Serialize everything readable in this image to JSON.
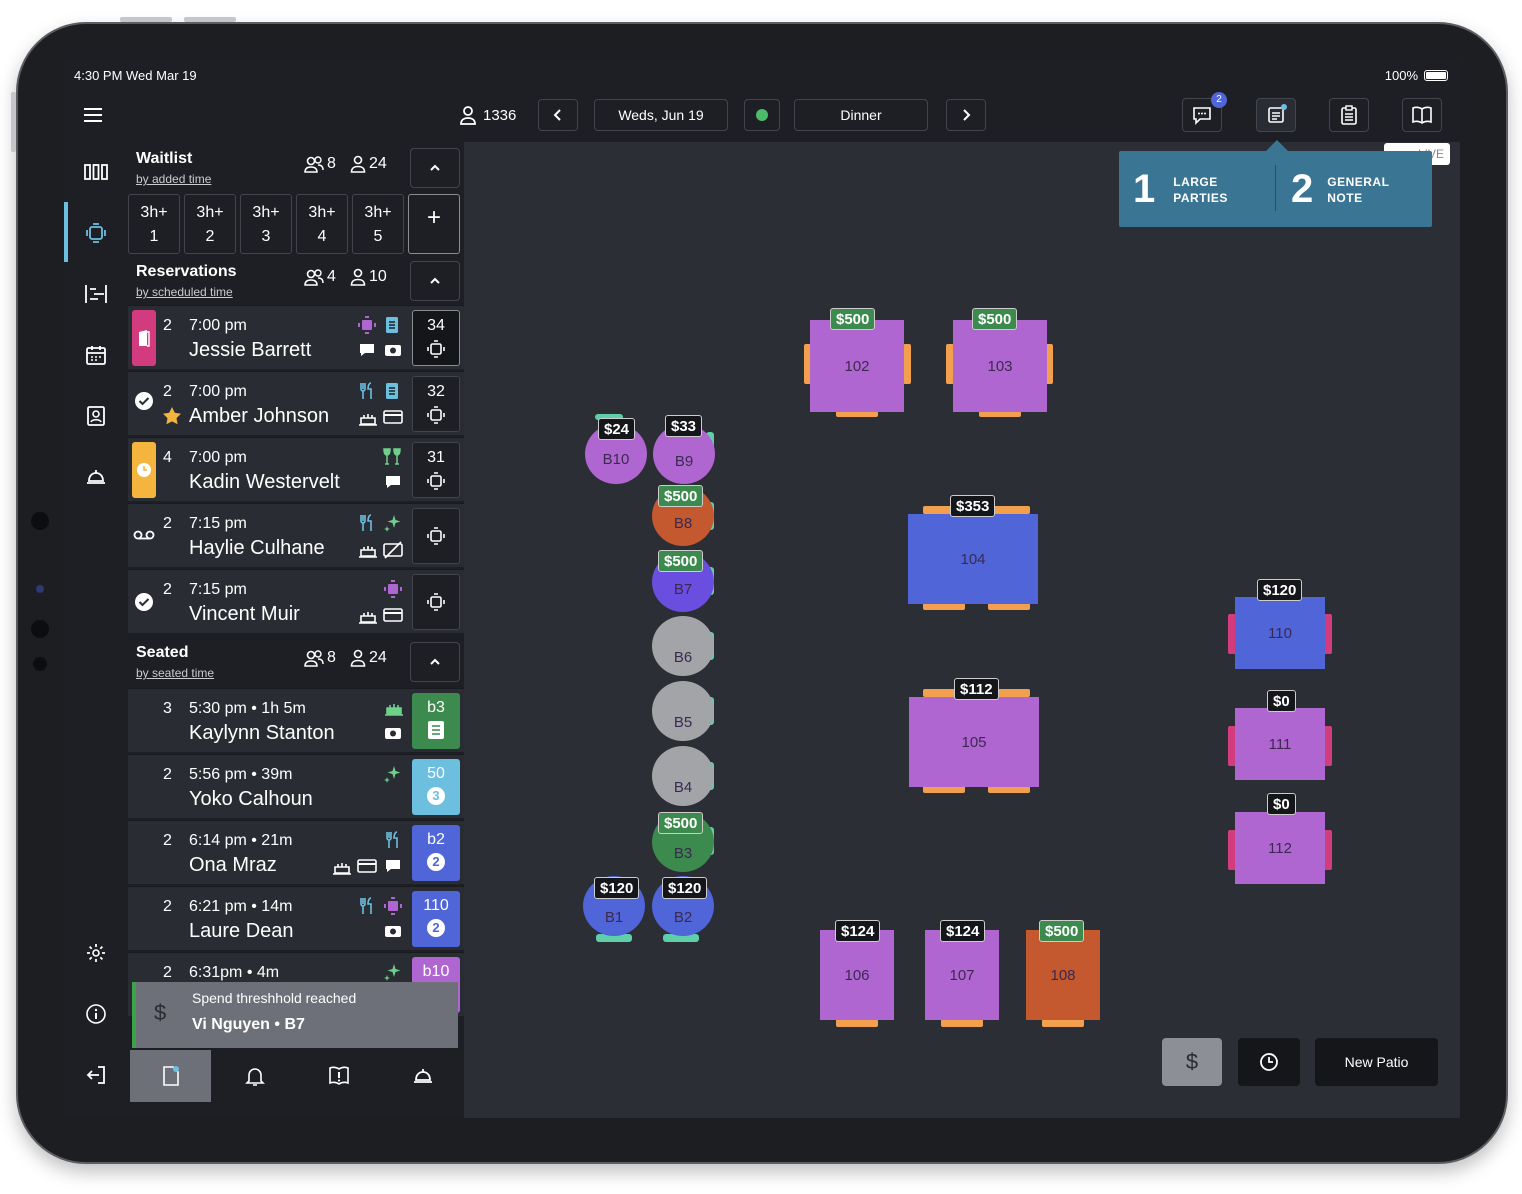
{
  "status_bar": {
    "time_date": "4:30 PM  Wed Mar 19",
    "battery": "100%"
  },
  "topbar": {
    "guest_count": "1336",
    "date": "Weds, Jun 19",
    "shift": "Dinner",
    "messages_badge": "2"
  },
  "popover": {
    "items": [
      {
        "count": "1",
        "line1": "LARGE",
        "line2": "PARTIES"
      },
      {
        "count": "2",
        "line1": "GENERAL",
        "line2": "NOTE"
      }
    ],
    "hidden_tag": "LIVE"
  },
  "waitlist": {
    "title": "Waitlist",
    "subtitle": "by added time",
    "parties": "8",
    "covers": "24",
    "entries": [
      {
        "time": "3h+",
        "num": "1"
      },
      {
        "time": "3h+",
        "num": "2"
      },
      {
        "time": "3h+",
        "num": "3"
      },
      {
        "time": "3h+",
        "num": "4"
      },
      {
        "time": "3h+",
        "num": "5"
      }
    ],
    "add_label": "+"
  },
  "reservations": {
    "title": "Reservations",
    "subtitle": "by scheduled time",
    "parties": "4",
    "covers": "10",
    "rows": [
      {
        "party": "2",
        "time": "7:00 pm",
        "name": "Jessie Barrett",
        "table": "34"
      },
      {
        "party": "2",
        "time": "7:00 pm",
        "name": "Amber Johnson",
        "table": "32"
      },
      {
        "party": "4",
        "time": "7:00 pm",
        "name": "Kadin Westervelt",
        "table": "31"
      },
      {
        "party": "2",
        "time": "7:15 pm",
        "name": "Haylie Culhane",
        "table": ""
      },
      {
        "party": "2",
        "time": "7:15 pm",
        "name": "Vincent Muir",
        "table": ""
      }
    ]
  },
  "seated": {
    "title": "Seated",
    "subtitle": "by seated time",
    "parties": "8",
    "covers": "24",
    "rows": [
      {
        "party": "3",
        "time": "5:30 pm • 1h 5m",
        "name": "Kaylynn Stanton",
        "table": "b3",
        "sub": "",
        "color": "#3c8a4d"
      },
      {
        "party": "2",
        "time": "5:56 pm • 39m",
        "name": "Yoko Calhoun",
        "table": "50",
        "sub": "3",
        "color": "#6dbfe0"
      },
      {
        "party": "2",
        "time": "6:14 pm • 21m",
        "name": "Ona Mraz",
        "table": "b2",
        "sub": "2",
        "color": "#4f65d8"
      },
      {
        "party": "2",
        "time": "6:21 pm • 14m",
        "name": "Laure Dean",
        "table": "110",
        "sub": "2",
        "color": "#4f65d8"
      },
      {
        "party": "2",
        "time": "6:31pm  • 4m",
        "name": "",
        "table": "b10",
        "sub": "",
        "color": "#b066d0"
      }
    ]
  },
  "toast": {
    "title": "Spend threshhold reached",
    "detail": "Vi Nguyen • B7",
    "icon": "$"
  },
  "floor": {
    "tables": [
      {
        "id": "102",
        "price": "$500",
        "price_style": "green",
        "fill": "#b066d0"
      },
      {
        "id": "103",
        "price": "$500",
        "price_style": "green",
        "fill": "#b066d0"
      },
      {
        "id": "B10",
        "price": "$24",
        "price_style": "dark",
        "fill": "#b066d0"
      },
      {
        "id": "B9",
        "price": "$33",
        "price_style": "dark",
        "fill": "#b066d0"
      },
      {
        "id": "B8",
        "price": "$500",
        "price_style": "green",
        "fill": "#c4582e"
      },
      {
        "id": "B7",
        "price": "$500",
        "price_style": "green",
        "fill": "#6a4ee0"
      },
      {
        "id": "B6",
        "price": "",
        "price_style": "",
        "fill": "#a3a4a8"
      },
      {
        "id": "B5",
        "price": "",
        "price_style": "",
        "fill": "#a3a4a8"
      },
      {
        "id": "B4",
        "price": "",
        "price_style": "",
        "fill": "#a3a4a8"
      },
      {
        "id": "B3",
        "price": "$500",
        "price_style": "green",
        "fill": "#3c8a4d"
      },
      {
        "id": "B1",
        "price": "$120",
        "price_style": "dark",
        "fill": "#4f65d8"
      },
      {
        "id": "B2",
        "price": "$120",
        "price_style": "dark",
        "fill": "#4f65d8"
      },
      {
        "id": "104",
        "price": "$353",
        "price_style": "dark",
        "fill": "#4f65d8"
      },
      {
        "id": "105",
        "price": "$112",
        "price_style": "dark",
        "fill": "#b066d0"
      },
      {
        "id": "110",
        "price": "$120",
        "price_style": "dark",
        "fill": "#4f65d8"
      },
      {
        "id": "111",
        "price": "$0",
        "price_style": "dark",
        "fill": "#b066d0"
      },
      {
        "id": "112",
        "price": "$0",
        "price_style": "dark",
        "fill": "#b066d0"
      },
      {
        "id": "106",
        "price": "$124",
        "price_style": "dark",
        "fill": "#b066d0"
      },
      {
        "id": "107",
        "price": "$124",
        "price_style": "dark",
        "fill": "#b066d0"
      },
      {
        "id": "108",
        "price": "$500",
        "price_style": "green",
        "fill": "#c4582e"
      }
    ],
    "buttons": {
      "spend": "$",
      "room": "New Patio"
    }
  },
  "icons": [
    "menu-icon",
    "floorplan-icon",
    "table-icon",
    "timeline-icon",
    "calendar-icon",
    "contacts-icon",
    "service-bell-icon",
    "settings-icon",
    "info-icon",
    "logout-icon",
    "person-icon",
    "chevron-left-icon",
    "chevron-right-icon",
    "chat-icon",
    "note-icon",
    "clipboard-icon",
    "book-icon",
    "clock-icon"
  ],
  "colors": {
    "accent": "#3b7594",
    "pink": "#d23b7e",
    "yellow": "#f3b53e",
    "chair": "#f2a04d"
  }
}
